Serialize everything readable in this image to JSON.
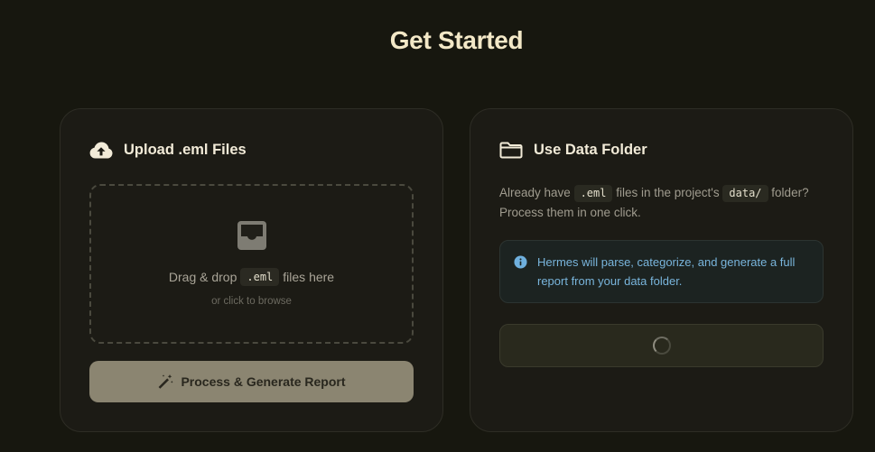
{
  "page": {
    "title": "Get Started"
  },
  "upload_card": {
    "icon": "cloud-upload-icon",
    "title": "Upload .eml Files",
    "dropzone": {
      "icon": "inbox-icon",
      "text_before": "Drag & drop",
      "file_ext": ".eml",
      "text_after": "files here",
      "hint": "or click to browse"
    },
    "process_button": {
      "icon": "magic-wand-icon",
      "label": "Process & Generate Report"
    }
  },
  "folder_card": {
    "icon": "folder-icon",
    "title": "Use Data Folder",
    "description": {
      "text_1": "Already have",
      "code_1": ".eml",
      "text_2": "files in the project's",
      "code_2": "data/",
      "text_3": "folder? Process them in one click."
    },
    "info_notice": {
      "icon": "info-icon",
      "text": "Hermes will parse, categorize, and generate a full report from your data folder."
    },
    "run_button": {
      "icon": "spinner-icon"
    }
  },
  "colors": {
    "background": "#17170f",
    "card_background": "#1c1b15",
    "heading": "#f3e8c7",
    "body_text": "#a09c8f",
    "accent_button": "#8b8571",
    "info_text": "#79b5dc",
    "info_icon": "#6fb0de"
  }
}
